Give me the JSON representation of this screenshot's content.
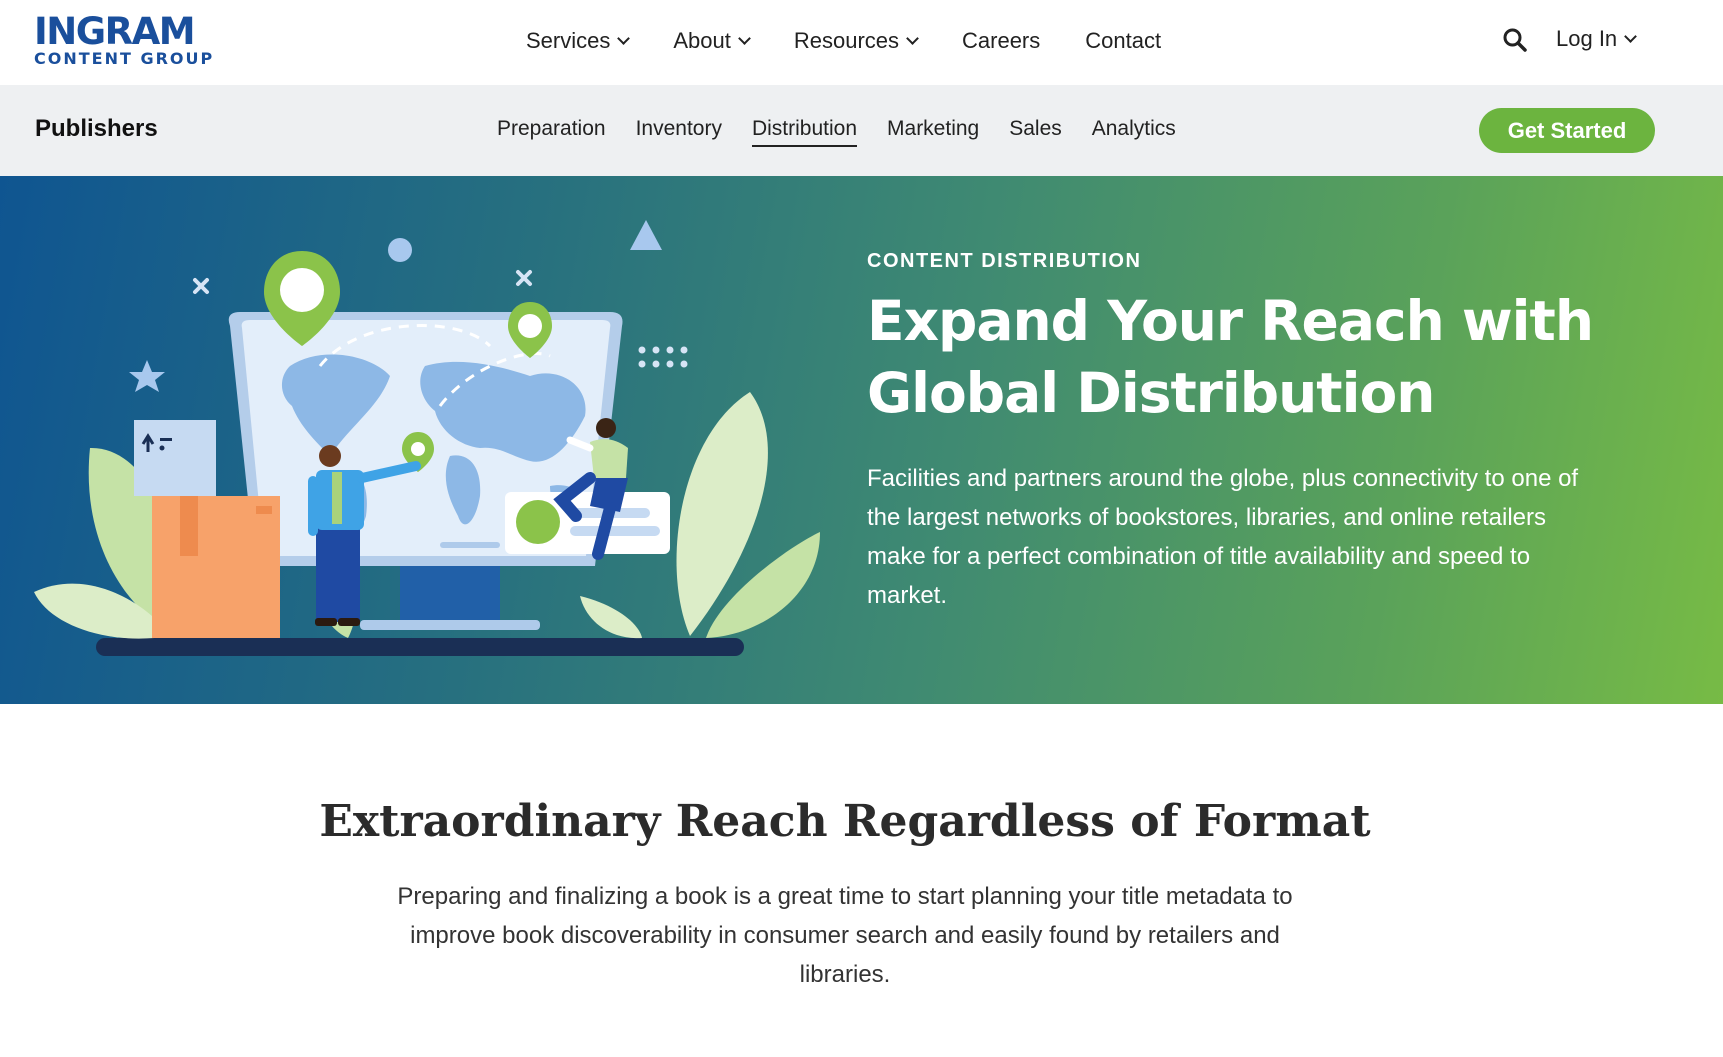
{
  "brand": {
    "logo_main": "INGRAM",
    "logo_sub": "CONTENT GROUP",
    "primary_color": "#1a4f9c",
    "accent_color": "#6cb43f"
  },
  "header": {
    "nav": [
      {
        "label": "Services",
        "dropdown": true
      },
      {
        "label": "About",
        "dropdown": true
      },
      {
        "label": "Resources",
        "dropdown": true
      },
      {
        "label": "Careers",
        "dropdown": false
      },
      {
        "label": "Contact",
        "dropdown": false
      }
    ],
    "search_icon": "search-icon",
    "login_label": "Log In"
  },
  "subnav": {
    "title": "Publishers",
    "links": [
      {
        "label": "Preparation",
        "active": false
      },
      {
        "label": "Inventory",
        "active": false
      },
      {
        "label": "Distribution",
        "active": true
      },
      {
        "label": "Marketing",
        "active": false
      },
      {
        "label": "Sales",
        "active": false
      },
      {
        "label": "Analytics",
        "active": false
      }
    ],
    "cta_label": "Get Started"
  },
  "hero": {
    "eyebrow": "CONTENT DISTRIBUTION",
    "title_line1": "Expand Your Reach with",
    "title_line2": "Global Distribution",
    "body": "Facilities and partners around the globe, plus connectivity to one of the largest networks of bookstores, libraries, and online retailers make for a perfect combination of title availability and speed to market."
  },
  "section": {
    "title": "Extraordinary Reach Regardless of Format",
    "body": "Preparing and finalizing a book is a great time to start planning your title metadata to improve book discoverability in consumer search and easily found by retailers and libraries."
  }
}
